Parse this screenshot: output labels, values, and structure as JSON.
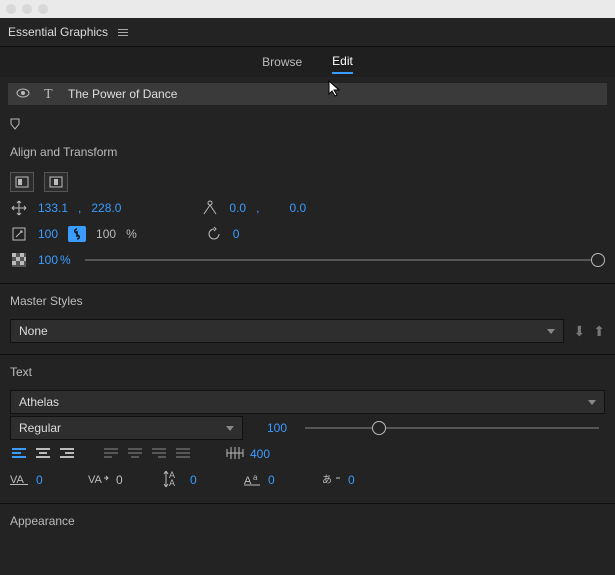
{
  "panel": {
    "title": "Essential Graphics"
  },
  "tabs": {
    "browse": "Browse",
    "edit": "Edit"
  },
  "layer": {
    "name": "The Power of Dance"
  },
  "sections": {
    "align_transform": "Align and Transform",
    "master_styles": "Master Styles",
    "text": "Text",
    "appearance": "Appearance"
  },
  "transform": {
    "pos_x": "133.1",
    "pos_sep": ",",
    "pos_y": "228.0",
    "anchor_x": "0.0",
    "anchor_sep": ",",
    "anchor_y": "0.0",
    "scale_w": "100",
    "scale_h": "100",
    "scale_unit": "%",
    "rotation": "0",
    "opacity": "100",
    "opacity_unit": "%"
  },
  "master_styles": {
    "value": "None"
  },
  "text": {
    "font": "Athelas",
    "style": "Regular",
    "size": "100",
    "tracking_value": "400",
    "props": {
      "kerning": "0",
      "tracking": "0",
      "leading": "0",
      "baseline": "0",
      "tsume": "0"
    }
  }
}
